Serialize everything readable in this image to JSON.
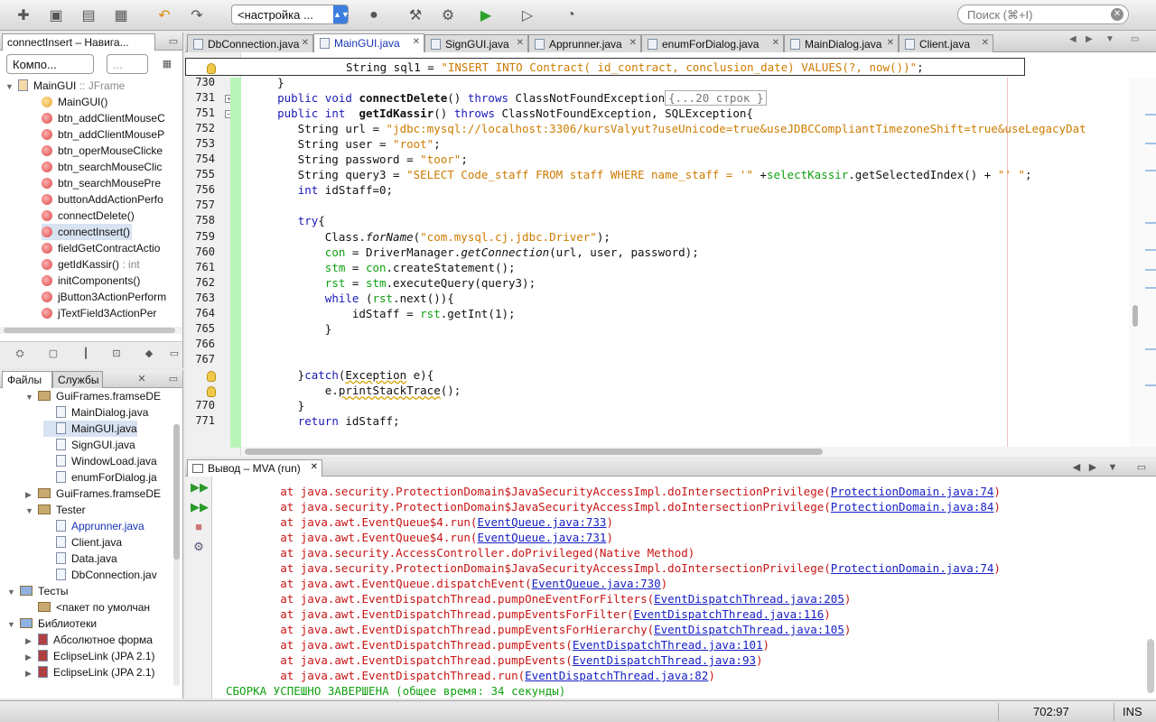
{
  "toolbar": {
    "config_value": "<настройка ...",
    "search_placeholder": "Поиск (⌘+I)",
    "icons": [
      "new-file-icon",
      "new-project-icon",
      "open-project-icon",
      "close-project-icon",
      "undo-icon",
      "redo-icon",
      "globe-icon",
      "hammer-icon",
      "clean-build-icon",
      "run-icon",
      "debug-icon",
      "profile-icon"
    ]
  },
  "navigator": {
    "tab_label": "connectInsert – Навига...",
    "combo_value": "Компо...",
    "combo2_value": "...",
    "root": "MainGUI",
    "root_type": ":: JFrame",
    "items": [
      {
        "label": "MainGUI()",
        "kind": "ctor"
      },
      {
        "label": "btn_addClientMouseC",
        "kind": "method"
      },
      {
        "label": "btn_addClientMouseP",
        "kind": "method"
      },
      {
        "label": "btn_operMouseClicke",
        "kind": "method"
      },
      {
        "label": "btn_searchMouseClic",
        "kind": "method"
      },
      {
        "label": "btn_searchMousePre",
        "kind": "method"
      },
      {
        "label": "buttonAddActionPerfo",
        "kind": "method"
      },
      {
        "label": "connectDelete()",
        "kind": "method"
      },
      {
        "label": "connectInsert()",
        "kind": "method",
        "selected": true
      },
      {
        "label": "fieldGetContractActio",
        "kind": "method"
      },
      {
        "label": "getIdKassir()",
        "suffix": ": int",
        "kind": "method"
      },
      {
        "label": "initComponents()",
        "kind": "method"
      },
      {
        "label": "jButton3ActionPerform",
        "kind": "method"
      },
      {
        "label": "jTextField3ActionPer",
        "kind": "method"
      }
    ]
  },
  "projects": {
    "tab_files": "Файлы",
    "tab_services": "Службы",
    "items": [
      {
        "label": "GuiFrames.framseDE",
        "kind": "package",
        "indent": 1,
        "toggle": "▼"
      },
      {
        "label": "MainDialog.java",
        "kind": "file",
        "indent": 2
      },
      {
        "label": "MainGUI.java",
        "kind": "file",
        "indent": 2,
        "selected": true
      },
      {
        "label": "SignGUI.java",
        "kind": "file",
        "indent": 2
      },
      {
        "label": "WindowLoad.java",
        "kind": "file",
        "indent": 2
      },
      {
        "label": "enumForDialog.ja",
        "kind": "file",
        "indent": 2
      },
      {
        "label": "GuiFrames.framseDE",
        "kind": "package",
        "indent": 1,
        "toggle": "▶"
      },
      {
        "label": "Tester",
        "kind": "package",
        "indent": 1,
        "toggle": "▼"
      },
      {
        "label": "Apprunner.java",
        "kind": "file",
        "indent": 2,
        "blue": true
      },
      {
        "label": "Client.java",
        "kind": "file",
        "indent": 2
      },
      {
        "label": "Data.java",
        "kind": "file",
        "indent": 2
      },
      {
        "label": "DbConnection.jav",
        "kind": "file",
        "indent": 2
      },
      {
        "label": "Тесты",
        "kind": "folder",
        "indent": 0,
        "toggle": "▼"
      },
      {
        "label": "<пакет по умолчан",
        "kind": "package",
        "indent": 1
      },
      {
        "label": "Библиотеки",
        "kind": "folder",
        "indent": 0,
        "toggle": "▼"
      },
      {
        "label": "Абсолютное форма",
        "kind": "lib",
        "indent": 1,
        "toggle": "▶"
      },
      {
        "label": "EclipseLink (JPA 2.1)",
        "kind": "lib",
        "indent": 1,
        "toggle": "▶"
      },
      {
        "label": "EclipseLink (JPA 2.1)",
        "kind": "lib",
        "indent": 1,
        "toggle": "▶"
      }
    ]
  },
  "editor_tabs": [
    {
      "label": "DbConnection.java"
    },
    {
      "label": "MainGUI.java",
      "active": true
    },
    {
      "label": "SignGUI.java"
    },
    {
      "label": "Apprunner.java"
    },
    {
      "label": "enumForDialog.java"
    },
    {
      "label": "MainDialog.java"
    },
    {
      "label": "Client.java"
    }
  ],
  "editor": {
    "popup_line": "String sql1 = \"INSERT INTO Contract( id_contract, conclusion_date) VALUES(?, now())\";",
    "fold_text": "{...20 строк }",
    "lines": [
      {
        "n": "730",
        "code": "    }"
      },
      {
        "n": "731",
        "code": "    public void connectDelete() throws ClassNotFoundException"
      },
      {
        "n": "751",
        "code": "    public int  getIdKassir() throws ClassNotFoundException, SQLException{"
      },
      {
        "n": "752",
        "code": "       String url = \"jdbc:mysql://localhost:3306/kursValyut?useUnicode=true&useJDBCCompliantTimezoneShift=true&useLegacyDat"
      },
      {
        "n": "753",
        "code": "       String user = \"root\";"
      },
      {
        "n": "754",
        "code": "       String password = \"toor\";"
      },
      {
        "n": "755",
        "code": "       String query3 = \"SELECT Code_staff FROM staff WHERE name_staff = '\" +selectKassir.getSelectedIndex() + \"' \";"
      },
      {
        "n": "756",
        "code": "       int idStaff=0;"
      },
      {
        "n": "757",
        "code": ""
      },
      {
        "n": "758",
        "code": "       try{"
      },
      {
        "n": "759",
        "code": "           Class.forName(\"com.mysql.cj.jdbc.Driver\");"
      },
      {
        "n": "760",
        "code": "           con = DriverManager.getConnection(url, user, password);"
      },
      {
        "n": "761",
        "code": "           stm = con.createStatement();"
      },
      {
        "n": "762",
        "code": "           rst = stm.executeQuery(query3);"
      },
      {
        "n": "763",
        "code": "           while (rst.next()){"
      },
      {
        "n": "764",
        "code": "               idStaff = rst.getInt(1);"
      },
      {
        "n": "765",
        "code": "           }"
      },
      {
        "n": "766",
        "code": ""
      },
      {
        "n": "767",
        "code": ""
      },
      {
        "n": "",
        "code": "       }catch(Exception e){"
      },
      {
        "n": "",
        "code": "           e.printStackTrace();"
      },
      {
        "n": "770",
        "code": "       }"
      },
      {
        "n": "771",
        "code": "       return idStaff;"
      }
    ]
  },
  "output": {
    "tab_label": "Вывод – MVA (run)",
    "lines": [
      {
        "pre": "        at java.security.ProtectionDomain$JavaSecurityAccessImpl.doIntersectionPrivilege(",
        "link": "ProtectionDomain.java:74",
        "post": ")"
      },
      {
        "pre": "        at java.security.ProtectionDomain$JavaSecurityAccessImpl.doIntersectionPrivilege(",
        "link": "ProtectionDomain.java:84",
        "post": ")"
      },
      {
        "pre": "        at java.awt.EventQueue$4.run(",
        "link": "EventQueue.java:733",
        "post": ")"
      },
      {
        "pre": "        at java.awt.EventQueue$4.run(",
        "link": "EventQueue.java:731",
        "post": ")"
      },
      {
        "pre": "        at java.security.AccessController.doPrivileged(Native Method)",
        "link": "",
        "post": ""
      },
      {
        "pre": "        at java.security.ProtectionDomain$JavaSecurityAccessImpl.doIntersectionPrivilege(",
        "link": "ProtectionDomain.java:74",
        "post": ")"
      },
      {
        "pre": "        at java.awt.EventQueue.dispatchEvent(",
        "link": "EventQueue.java:730",
        "post": ")"
      },
      {
        "pre": "        at java.awt.EventDispatchThread.pumpOneEventForFilters(",
        "link": "EventDispatchThread.java:205",
        "post": ")"
      },
      {
        "pre": "        at java.awt.EventDispatchThread.pumpEventsForFilter(",
        "link": "EventDispatchThread.java:116",
        "post": ")"
      },
      {
        "pre": "        at java.awt.EventDispatchThread.pumpEventsForHierarchy(",
        "link": "EventDispatchThread.java:105",
        "post": ")"
      },
      {
        "pre": "        at java.awt.EventDispatchThread.pumpEvents(",
        "link": "EventDispatchThread.java:101",
        "post": ")"
      },
      {
        "pre": "        at java.awt.EventDispatchThread.pumpEvents(",
        "link": "EventDispatchThread.java:93",
        "post": ")"
      },
      {
        "pre": "        at java.awt.EventDispatchThread.run(",
        "link": "EventDispatchThread.java:82",
        "post": ")"
      }
    ],
    "success": "СБОРКА УСПЕШНО ЗАВЕРШЕНА (общее время: 34 секунды)"
  },
  "status": {
    "position": "702:97",
    "mode": "INS"
  },
  "colors": {
    "keyword": "#1a1ab8",
    "string": "#ce7b00",
    "error": "#c81414",
    "success": "#10a010",
    "link": "#1720c4"
  }
}
